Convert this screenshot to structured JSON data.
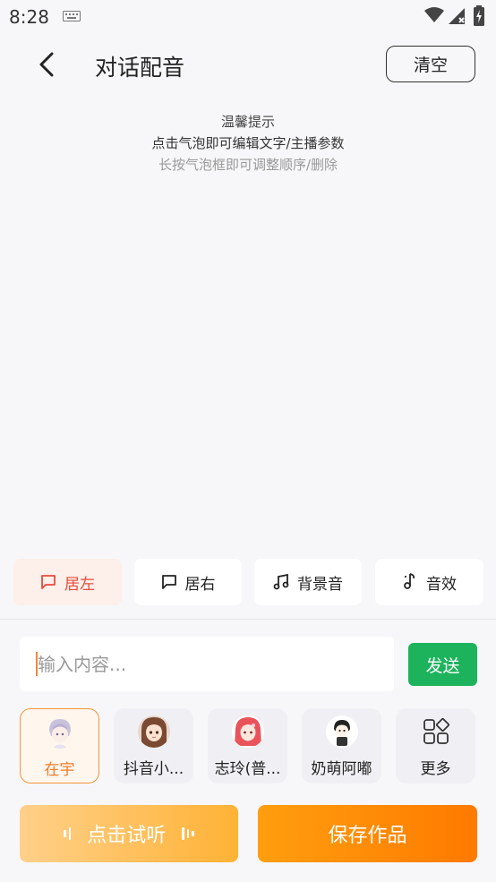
{
  "status_bar": {
    "time": "8:28"
  },
  "header": {
    "title": "对话配音",
    "clear_label": "清空"
  },
  "tips": {
    "title": "温馨提示",
    "line1": "点击气泡即可编辑文字/主播参数",
    "line2": "长按气泡框即可调整顺序/删除"
  },
  "modes": [
    {
      "label": "居左",
      "icon": "chat-bubble-icon",
      "active": true
    },
    {
      "label": "居右",
      "icon": "chat-bubble-icon",
      "active": false
    },
    {
      "label": "背景音",
      "icon": "music-note-icon",
      "active": false
    },
    {
      "label": "音效",
      "icon": "sound-effect-icon",
      "active": false
    }
  ],
  "composer": {
    "placeholder": "输入内容...",
    "value": "",
    "send_label": "发送"
  },
  "voices": [
    {
      "name": "在宇",
      "selected": true
    },
    {
      "name": "抖音小...",
      "selected": false
    },
    {
      "name": "志玲(普...",
      "selected": false
    },
    {
      "name": "奶萌阿嘟",
      "selected": false
    },
    {
      "name": "更多",
      "selected": false
    }
  ],
  "actions": {
    "listen_label": "点击试听",
    "save_label": "保存作品"
  },
  "colors": {
    "accent_orange": "#ff8a00",
    "send_green": "#1cb35c",
    "active_red": "#e84b3c"
  }
}
